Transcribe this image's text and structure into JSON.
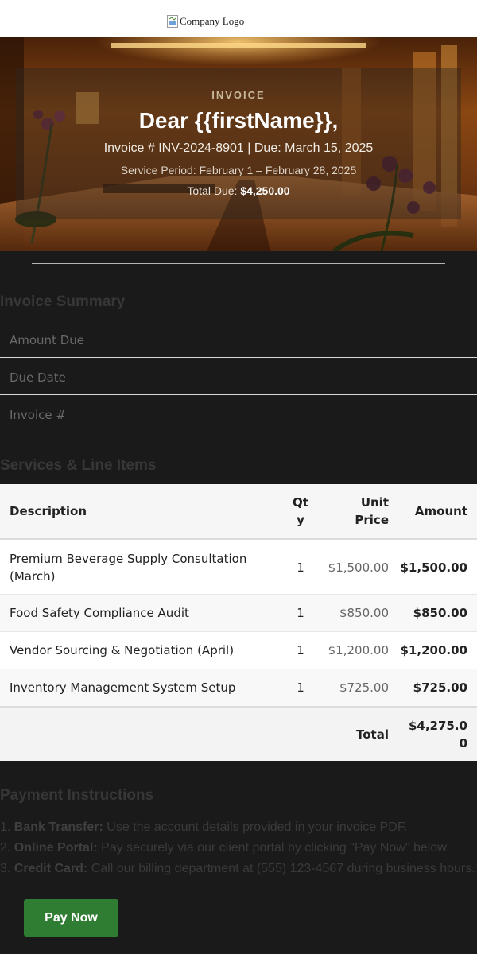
{
  "logo": {
    "alt_text": "Company Logo",
    "icon": "broken-image-icon"
  },
  "hero": {
    "eyebrow": "INVOICE",
    "greeting": "Dear {{firstName}},",
    "invoice_line": "Invoice # INV-2024-8901 | Due: March 15, 2025",
    "service_period": "Service Period: February 1 – February 28, 2025",
    "total_label": "Total Due:",
    "total_value": "$4,250.00"
  },
  "summary": {
    "title": "Invoice Summary",
    "rows": [
      {
        "label": "Amount Due"
      },
      {
        "label": "Due Date"
      },
      {
        "label": "Invoice #"
      }
    ]
  },
  "services": {
    "title": "Services & Line Items",
    "headers": {
      "description": "Description",
      "qty_line1": "Qt",
      "qty_line2": "y",
      "unit_line1": "Unit",
      "unit_line2": "Price",
      "amount": "Amount"
    },
    "items": [
      {
        "desc_line1": "Premium Beverage Supply Consultation",
        "desc_line2": "(March)",
        "qty": "1",
        "unit": "$1,500.00",
        "amount": "$1,500.00"
      },
      {
        "desc_line1": "Food Safety Compliance Audit",
        "desc_line2": "",
        "qty": "1",
        "unit": "$850.00",
        "amount": "$850.00"
      },
      {
        "desc_line1": "Vendor Sourcing & Negotiation (April)",
        "desc_line2": "",
        "qty": "1",
        "unit": "$1,200.00",
        "amount": "$1,200.00"
      },
      {
        "desc_line1": "Inventory Management System Setup",
        "desc_line2": "",
        "qty": "1",
        "unit": "$725.00",
        "amount": "$725.00"
      }
    ],
    "total_label": "Total",
    "total_line1": "$4,275.0",
    "total_line2": "0"
  },
  "payment": {
    "title": "Payment Instructions",
    "items": [
      {
        "num": "1.",
        "method": "Bank Transfer:",
        "text": "Use the account details provided in your invoice PDF."
      },
      {
        "num": "2.",
        "method": "Online Portal:",
        "text": "Pay securely via our client portal by clicking \"Pay Now\" below."
      },
      {
        "num": "3.",
        "method": "Credit Card:",
        "text": "Call our billing department at (555) 123-4567 during business hours."
      }
    ],
    "button_label": "Pay Now",
    "button_color": "#2e7d32"
  }
}
